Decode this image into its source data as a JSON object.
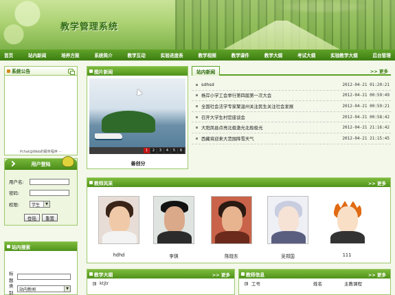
{
  "site": {
    "title": "教学管理系统"
  },
  "nav": [
    "首页",
    "站内新闻",
    "培养方案",
    "系统简介",
    "教学互动",
    "实验进度表",
    "教学视频",
    "教学课件",
    "教学大纲",
    "考试大纲",
    "实验教学大纲",
    "后台管理"
  ],
  "notice": {
    "title": "系统公告",
    "scroll_text": "Pchat@Web的服务程序 ···"
  },
  "login": {
    "title": "用户登陆",
    "username_label": "用户名:",
    "password_label": "密码:",
    "role_label": "权限:",
    "role_value": "学生",
    "login_button": "登陆",
    "reset_button": "重置"
  },
  "search": {
    "title": "站内搜索",
    "keyword_label": "标题",
    "category_label": "类别",
    "category_value": "站内新闻"
  },
  "picnews": {
    "title": "图片新闻",
    "caption": "善创分",
    "pager": [
      "1",
      "2",
      "3",
      "4",
      "5",
      "6"
    ],
    "active_page": "1"
  },
  "sitenews": {
    "tab": "站内新闻",
    "more": ">> 更多",
    "items": [
      {
        "title": "sdhsd",
        "date": "2012-04-21 01:20:21"
      },
      {
        "title": "杨岸小学工会举行第四届第一次大会",
        "date": "2012-04-21 00:59:49"
      },
      {
        "title": "全国社会法学专家聚温州关注民生关注社会发展",
        "date": "2012-04-21 00:59:21"
      },
      {
        "title": "召开大学生村官座谈会",
        "date": "2012-04-21 00:58:42"
      },
      {
        "title": "大阳凤县点亮北极激光北极极光",
        "date": "2012-04-21 21:16:42"
      },
      {
        "title": "西藏将迎来大范围降雪天气",
        "date": "2012-04-21 21:15:45"
      }
    ]
  },
  "teachers": {
    "title": "教师风采",
    "more": ">> 更多",
    "list": [
      {
        "name": "hdhd"
      },
      {
        "name": "李琪"
      },
      {
        "name": "陈晓东"
      },
      {
        "name": "吴郑国"
      },
      {
        "name": "111"
      }
    ]
  },
  "syllabus": {
    "title": "教学大纲",
    "more": ">> 更多",
    "first_item": "ktjtr"
  },
  "tinfo": {
    "title": "教师信息",
    "more": ">> 更多",
    "col_id": "工号",
    "col_name": "姓名",
    "col_course": "主教课程"
  }
}
